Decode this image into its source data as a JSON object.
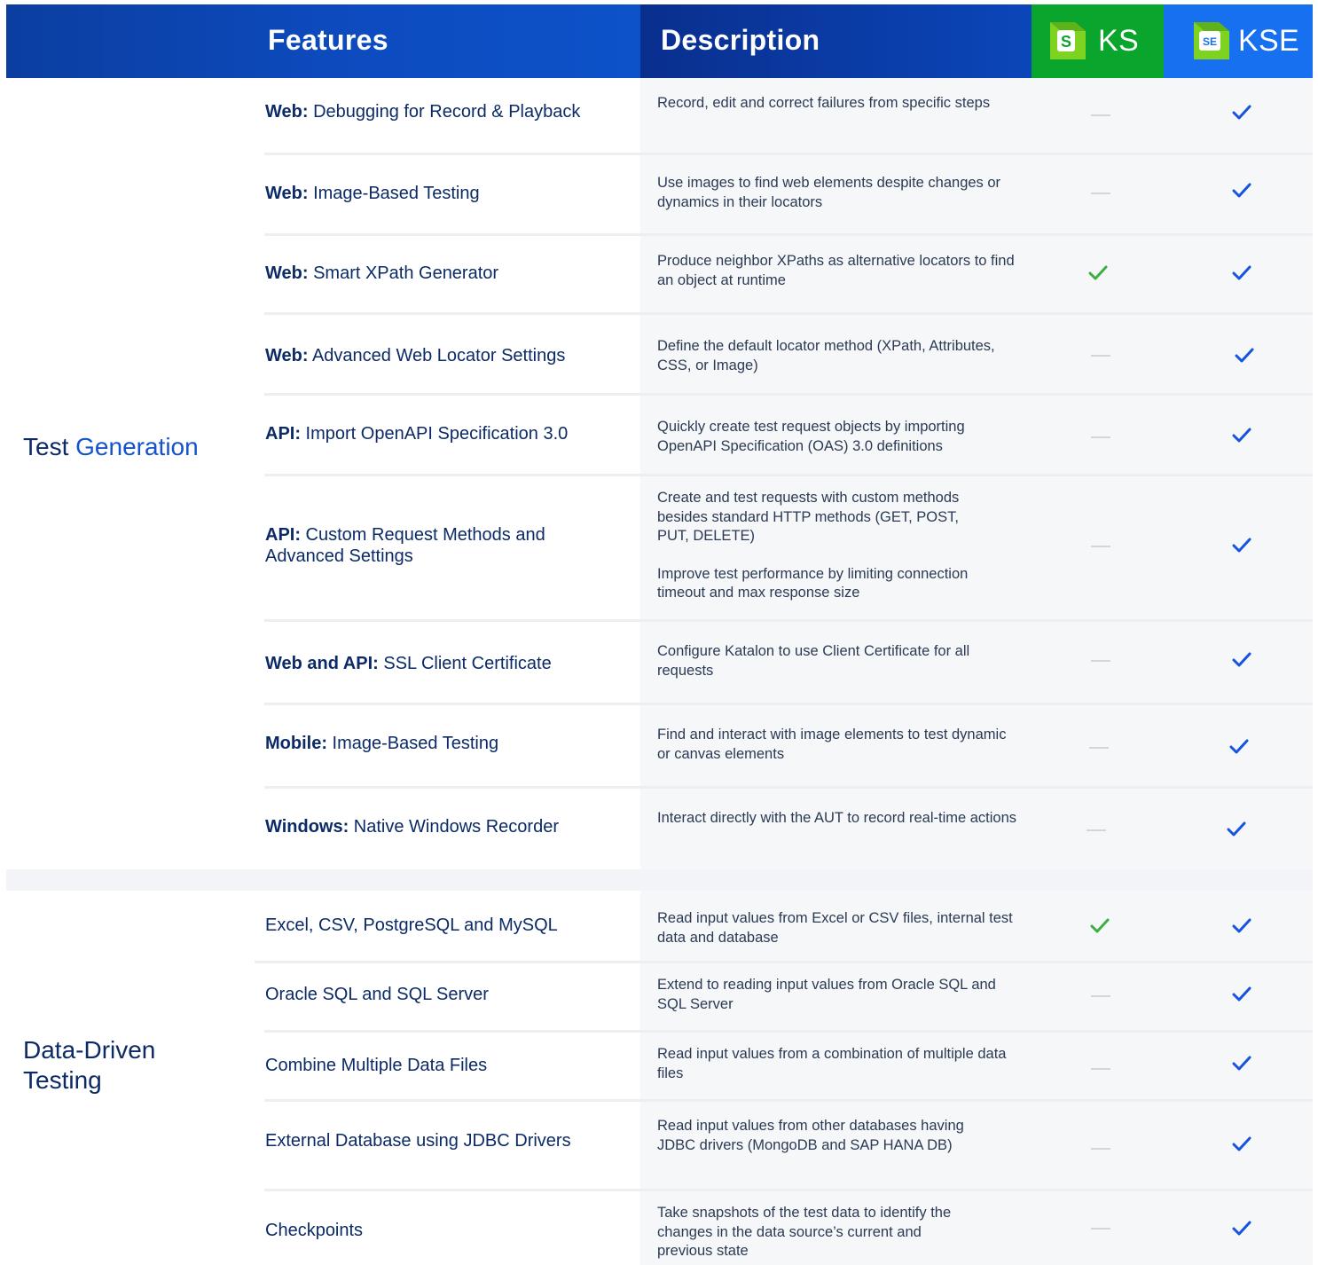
{
  "header": {
    "features_label": "Features",
    "description_label": "Description",
    "ks_label": "KS",
    "kse_label": "KSE",
    "ks_logo_letter": "S",
    "kse_logo_letters": "SE",
    "colors": {
      "ks": "#09a52d",
      "kse": "#1770ef",
      "navy": "#0b3ea0"
    }
  },
  "sections": [
    {
      "title_part1": "Test ",
      "title_part2": "Generation",
      "rows": [
        {
          "feature_bold": "Web:",
          "feature_rest": "  Debugging for Record & Playback",
          "description": [
            "Record, edit and correct failures from specific steps"
          ],
          "ks": "no",
          "kse": "yes"
        },
        {
          "feature_bold": "Web:",
          "feature_rest": " Image-Based Testing",
          "description": [
            "Use images to find web elements despite changes or dynamics in their locators"
          ],
          "ks": "no",
          "kse": "yes"
        },
        {
          "feature_bold": "Web:",
          "feature_rest": " Smart XPath Generator",
          "description": [
            "Produce neighbor XPaths as alternative locators to find an object at runtime"
          ],
          "ks": "yes",
          "kse": "yes"
        },
        {
          "feature_bold": "Web:",
          "feature_rest": " Advanced Web Locator Settings",
          "description": [
            "Define the default locator method (XPath, Attributes, CSS, or Image)"
          ],
          "ks": "no",
          "kse": "yes"
        },
        {
          "feature_bold": "API:",
          "feature_rest": " Import OpenAPI Specification 3.0",
          "description": [
            "Quickly create test request objects by importing OpenAPI Specification (OAS) 3.0 definitions"
          ],
          "ks": "no",
          "kse": "yes"
        },
        {
          "feature_bold": "API:",
          "feature_rest": " Custom Request Methods and Advanced Settings",
          "description": [
            "Create and test requests with custom methods besides standard HTTP methods (GET, POST, PUT, DELETE)",
            "Improve test performance by limiting connection timeout and max response size"
          ],
          "ks": "no",
          "kse": "yes"
        },
        {
          "feature_bold": "Web and API:",
          "feature_rest": " SSL Client Certificate",
          "description": [
            "Configure Katalon to use Client Certificate for all requests"
          ],
          "ks": "no",
          "kse": "yes"
        },
        {
          "feature_bold": "Mobile:",
          "feature_rest": " Image-Based Testing",
          "description": [
            "Find and interact with image elements to test dynamic or canvas elements"
          ],
          "ks": "no",
          "kse": "yes"
        },
        {
          "feature_bold": "Windows:",
          "feature_rest": " Native Windows Recorder",
          "description": [
            "Interact directly with the AUT to record real-time actions"
          ],
          "ks": "no",
          "kse": "yes"
        }
      ]
    },
    {
      "title_part1": "Data-Driven",
      "title_part2": "Testing",
      "rows": [
        {
          "feature_bold": "",
          "feature_rest": "Excel, CSV, PostgreSQL and MySQL",
          "description": [
            "Read input values from Excel or CSV files, internal test data and database"
          ],
          "ks": "yes",
          "kse": "yes"
        },
        {
          "feature_bold": "",
          "feature_rest": "Oracle SQL and SQL Server",
          "description": [
            "Extend to reading input values from Oracle SQL and SQL Server"
          ],
          "ks": "no",
          "kse": "yes"
        },
        {
          "feature_bold": "",
          "feature_rest": "Combine Multiple Data Files",
          "description": [
            "Read input values from a combination of multiple data files"
          ],
          "ks": "no",
          "kse": "yes"
        },
        {
          "feature_bold": "",
          "feature_rest": "External Database using JDBC Drivers",
          "description": [
            "Read input values from other databases having JDBC drivers (MongoDB and SAP HANA DB)"
          ],
          "ks": "no",
          "kse": "yes"
        },
        {
          "feature_bold": "",
          "feature_rest": "Checkpoints",
          "description": [
            "Take snapshots of the test data to identify the changes in the data source’s current and previous state"
          ],
          "ks": "no",
          "kse": "yes"
        }
      ]
    }
  ]
}
